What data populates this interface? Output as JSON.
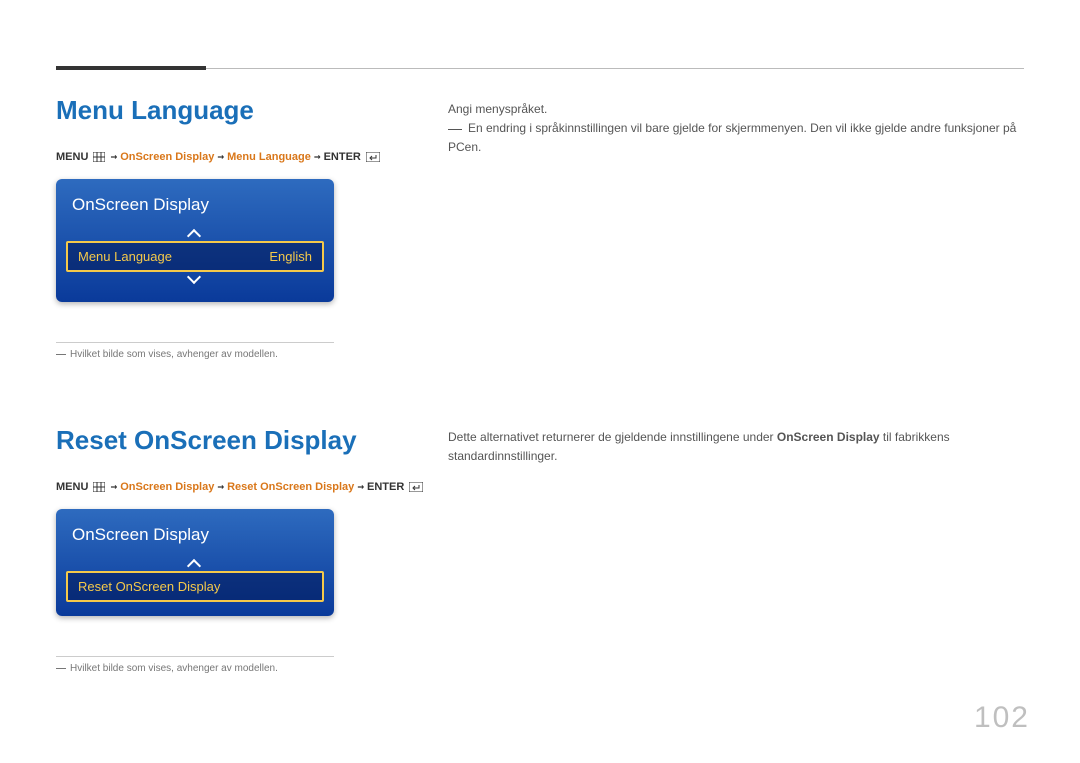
{
  "page_number": "102",
  "section1": {
    "heading": "Menu Language",
    "breadcrumb": {
      "menu": "MENU",
      "path1": "OnScreen Display",
      "path2": "Menu Language",
      "enter": "ENTER",
      "arrow": "→"
    },
    "osd": {
      "title": "OnScreen Display",
      "item_label": "Menu Language",
      "item_value": "English"
    },
    "footnote": "Hvilket bilde som vises, avhenger av modellen.",
    "right": {
      "line1": "Angi menyspråket.",
      "line2": "En endring i språkinnstillingen vil bare gjelde for skjermmenyen. Den vil ikke gjelde andre funksjoner på PCen."
    }
  },
  "section2": {
    "heading": "Reset OnScreen Display",
    "breadcrumb": {
      "menu": "MENU",
      "path1": "OnScreen Display",
      "path2": "Reset OnScreen Display",
      "enter": "ENTER",
      "arrow": "→"
    },
    "osd": {
      "title": "OnScreen Display",
      "item_label": "Reset OnScreen Display"
    },
    "footnote": "Hvilket bilde som vises, avhenger av modellen.",
    "right": {
      "prefix": "Dette alternativet returnerer de gjeldende innstillingene under ",
      "bold": "OnScreen Display",
      "suffix": " til fabrikkens standardinnstillinger."
    }
  }
}
